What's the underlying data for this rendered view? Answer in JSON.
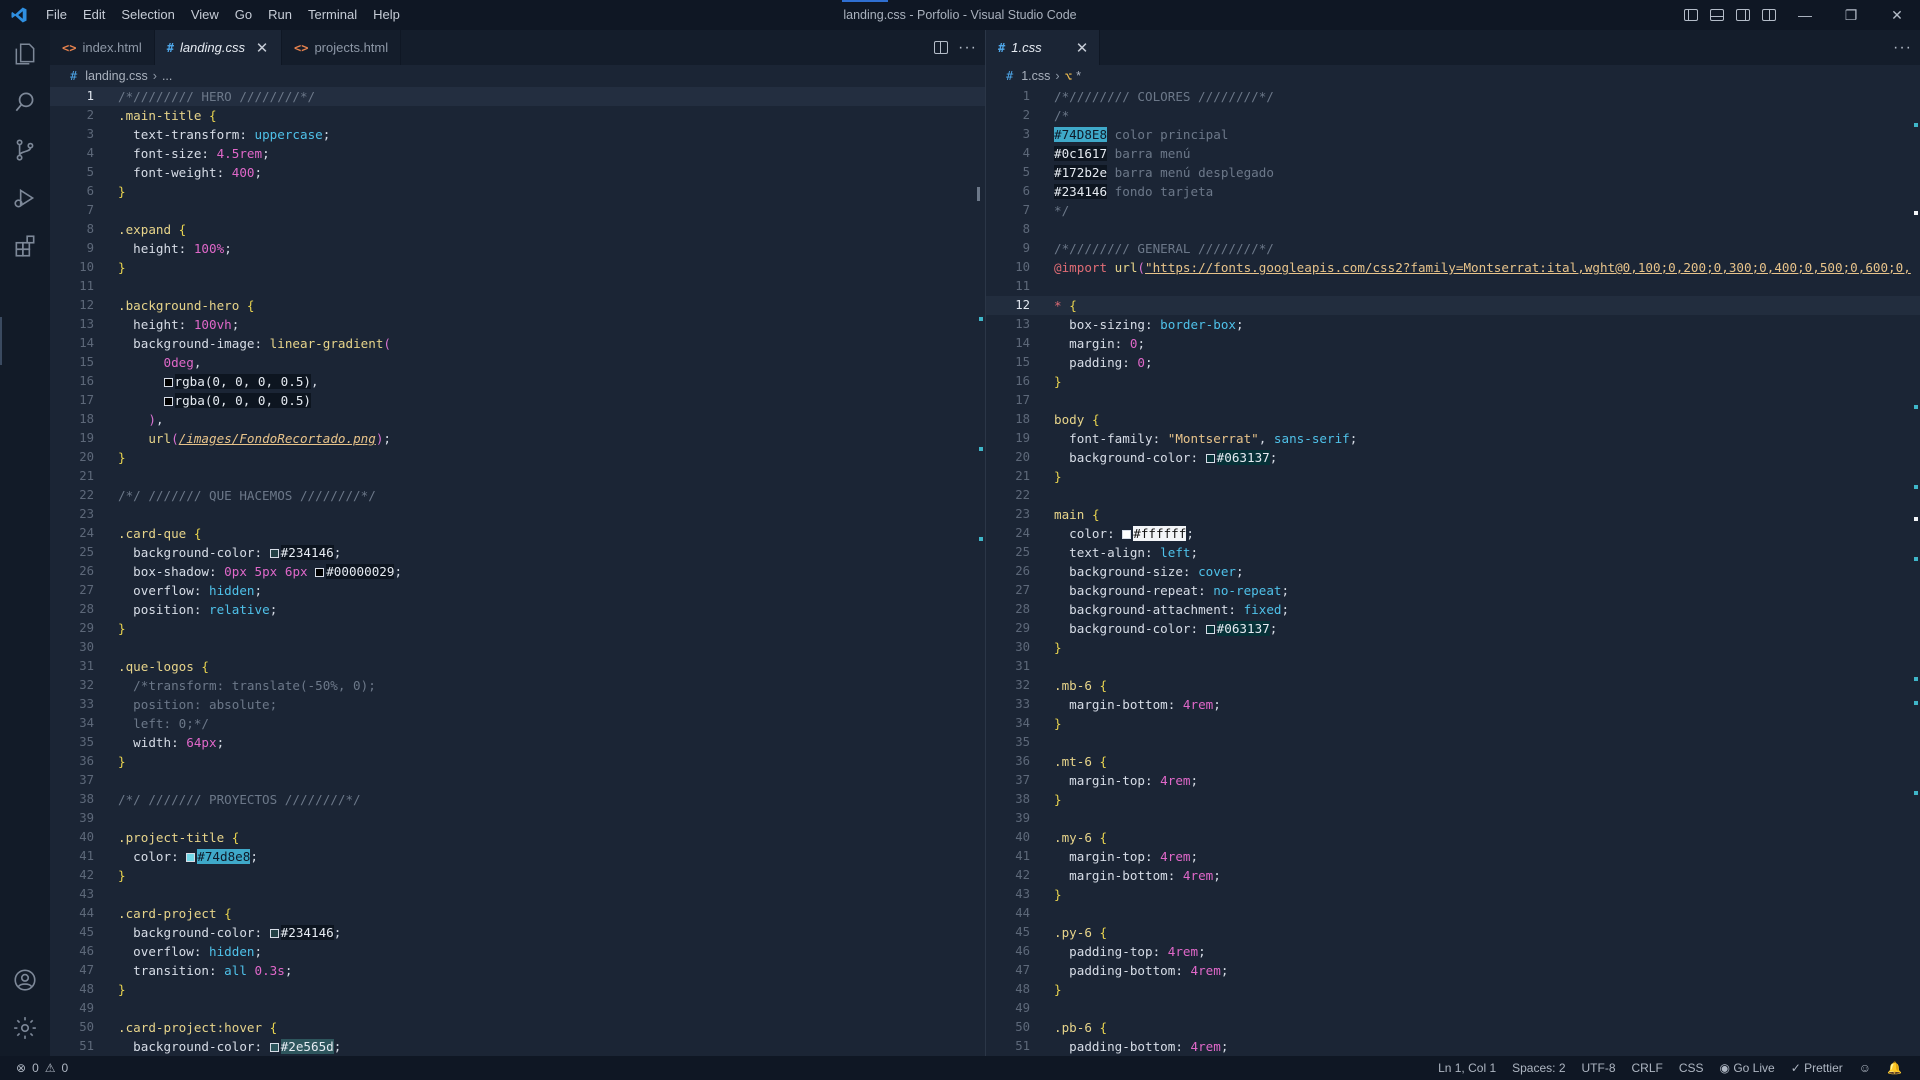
{
  "window": {
    "title": "landing.css - Porfolio - Visual Studio Code",
    "menu": [
      "File",
      "Edit",
      "Selection",
      "View",
      "Go",
      "Run",
      "Terminal",
      "Help"
    ]
  },
  "activity": [
    "explorer-icon",
    "search-icon",
    "source-control-icon",
    "run-debug-icon",
    "extensions-icon",
    "account-icon",
    "settings-gear-icon"
  ],
  "left_group": {
    "tabs": [
      {
        "label": "index.html",
        "type": "html",
        "active": false
      },
      {
        "label": "landing.css",
        "type": "css",
        "active": true,
        "close": "✕"
      },
      {
        "label": "projects.html",
        "type": "html",
        "active": false
      }
    ],
    "breadcrumb": {
      "file": "landing.css",
      "rest": "..."
    }
  },
  "right_group": {
    "tabs": [
      {
        "label": "1.css",
        "type": "css",
        "active": true,
        "close": "✕"
      }
    ],
    "breadcrumb": {
      "file": "1.css",
      "rest": "*"
    }
  },
  "colors": {
    "accent": "#2f6fd1",
    "editor_bg": "#1b2535",
    "swatch_74d8e8": "#74d8e8",
    "swatch_234146": "#234146",
    "swatch_2e565d": "#2e565d",
    "swatch_063137": "#063137",
    "swatch_ffffff": "#ffffff"
  },
  "status": {
    "problems": "0",
    "warnings": "0",
    "position": "Ln 1, Col 1",
    "spaces": "Spaces: 2",
    "encoding": "UTF-8",
    "eol": "CRLF",
    "language": "CSS",
    "golive": "Go Live",
    "prettier": "Prettier"
  }
}
